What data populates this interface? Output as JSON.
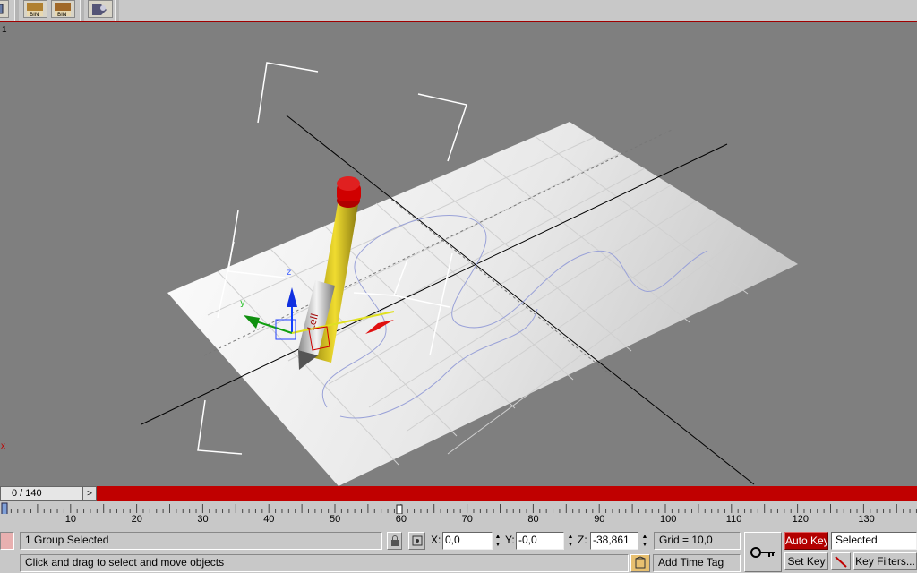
{
  "viewport": {
    "label": "1",
    "x_axis_label": "x"
  },
  "time_slider": {
    "value": "0 / 140",
    "next_arrow": ">"
  },
  "ruler": {
    "ticks": [
      "10",
      "20",
      "30",
      "40",
      "50",
      "60",
      "70",
      "80",
      "90",
      "100",
      "110",
      "120",
      "130"
    ]
  },
  "status": {
    "selection_text": "1 Group Selected",
    "prompt_text": "Click and drag to select and move objects",
    "x_label": "X:",
    "x_value": "0,0",
    "y_label": "Y:",
    "y_value": "-0,0",
    "z_label": "Z:",
    "z_value": "-38,861",
    "grid_text": "Grid = 10,0",
    "add_time_tag": "Add Time Tag",
    "auto_key": "Auto Key",
    "set_key": "Set Key",
    "selected_dropdown": "Selected",
    "key_filters": "Key Filters..."
  },
  "colors": {
    "accent_red": "#c00000",
    "ui_gray": "#c8c8c8",
    "viewport_gray": "#7f7f7f"
  },
  "icons": [
    "bin-icon",
    "bin-icon-2",
    "render-icon",
    "lock-icon",
    "key-icon",
    "time-tag-icon"
  ]
}
